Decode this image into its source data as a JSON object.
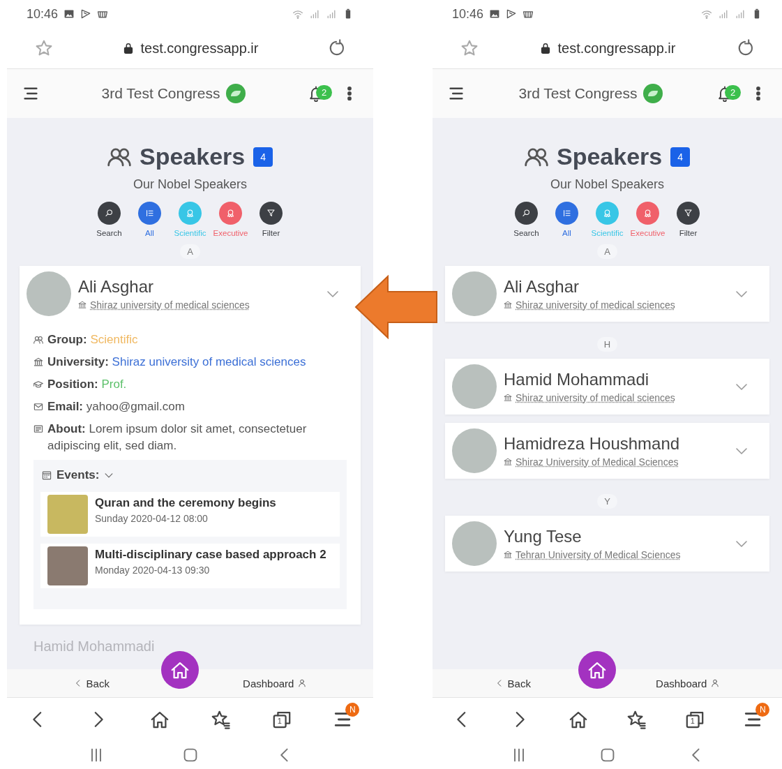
{
  "phones": [
    {
      "status": {
        "time": "10:46"
      },
      "browser": {
        "url": "test.congressapp.ir"
      },
      "app": {
        "title": "3rd Test Congress",
        "notifications": "2"
      },
      "page": {
        "title": "Speakers",
        "count": "4",
        "subtitle": "Our Nobel Speakers"
      },
      "filters": [
        {
          "label": "Search",
          "kind": "search",
          "color": "#3d4045"
        },
        {
          "label": "All",
          "kind": "all",
          "color": "#2f6fe0"
        },
        {
          "label": "Scientific",
          "kind": "scientific",
          "color": "#38c6e6"
        },
        {
          "label": "Executive",
          "kind": "executive",
          "color": "#f0606a"
        },
        {
          "label": "Filter",
          "kind": "filter",
          "color": "#3d4045"
        }
      ],
      "groups": [
        {
          "letter": "A",
          "speakers": [
            {
              "name": "Ali Asghar",
              "university": "Shiraz university of medical sciences",
              "details": {
                "fields": [
                  {
                    "kind": "group",
                    "label": "Group:",
                    "value": "Scientific"
                  },
                  {
                    "kind": "university",
                    "label": "University:",
                    "value": "Shiraz university of medical sciences"
                  },
                  {
                    "kind": "position",
                    "label": "Position:",
                    "value": "Prof."
                  },
                  {
                    "kind": "email",
                    "label": "Email:",
                    "value": "yahoo@gmail.com"
                  },
                  {
                    "kind": "about",
                    "label": "About:",
                    "value": "Lorem ipsum dolor sit amet, consectetuer adipiscing elit, sed diam."
                  }
                ],
                "events_label": "Events:",
                "events": [
                  {
                    "title": "Quran and the ceremony begins",
                    "date": "Sunday 2020-04-12 08:00"
                  },
                  {
                    "title": "Multi-disciplinary case based approach 2",
                    "date": "Monday 2020-04-13 09:30"
                  }
                ]
              }
            }
          ]
        }
      ],
      "peek": "Hamid Mohammadi",
      "app_nav": {
        "back": "Back",
        "dashboard": "Dashboard"
      },
      "toolbar": {
        "tabs": "1",
        "menu_badge": "N"
      }
    },
    {
      "status": {
        "time": "10:46"
      },
      "browser": {
        "url": "test.congressapp.ir"
      },
      "app": {
        "title": "3rd Test Congress",
        "notifications": "2"
      },
      "page": {
        "title": "Speakers",
        "count": "4",
        "subtitle": "Our Nobel Speakers"
      },
      "filters": [
        {
          "label": "Search",
          "kind": "search",
          "color": "#3d4045"
        },
        {
          "label": "All",
          "kind": "all",
          "color": "#2f6fe0"
        },
        {
          "label": "Scientific",
          "kind": "scientific",
          "color": "#38c6e6"
        },
        {
          "label": "Executive",
          "kind": "executive",
          "color": "#f0606a"
        },
        {
          "label": "Filter",
          "kind": "filter",
          "color": "#3d4045"
        }
      ],
      "groups": [
        {
          "letter": "A",
          "speakers": [
            {
              "name": "Ali Asghar",
              "university": "Shiraz university of medical sciences"
            }
          ]
        },
        {
          "letter": "H",
          "speakers": [
            {
              "name": "Hamid Mohammadi",
              "university": "Shiraz university of medical sciences"
            },
            {
              "name": "Hamidreza Houshmand",
              "university": "Shiraz University of Medical Sciences"
            }
          ]
        },
        {
          "letter": "Y",
          "speakers": [
            {
              "name": "Yung Tese",
              "university": "Tehran University of Medical Sciences"
            }
          ]
        }
      ],
      "app_nav": {
        "back": "Back",
        "dashboard": "Dashboard"
      },
      "toolbar": {
        "tabs": "1",
        "menu_badge": "N"
      }
    }
  ]
}
